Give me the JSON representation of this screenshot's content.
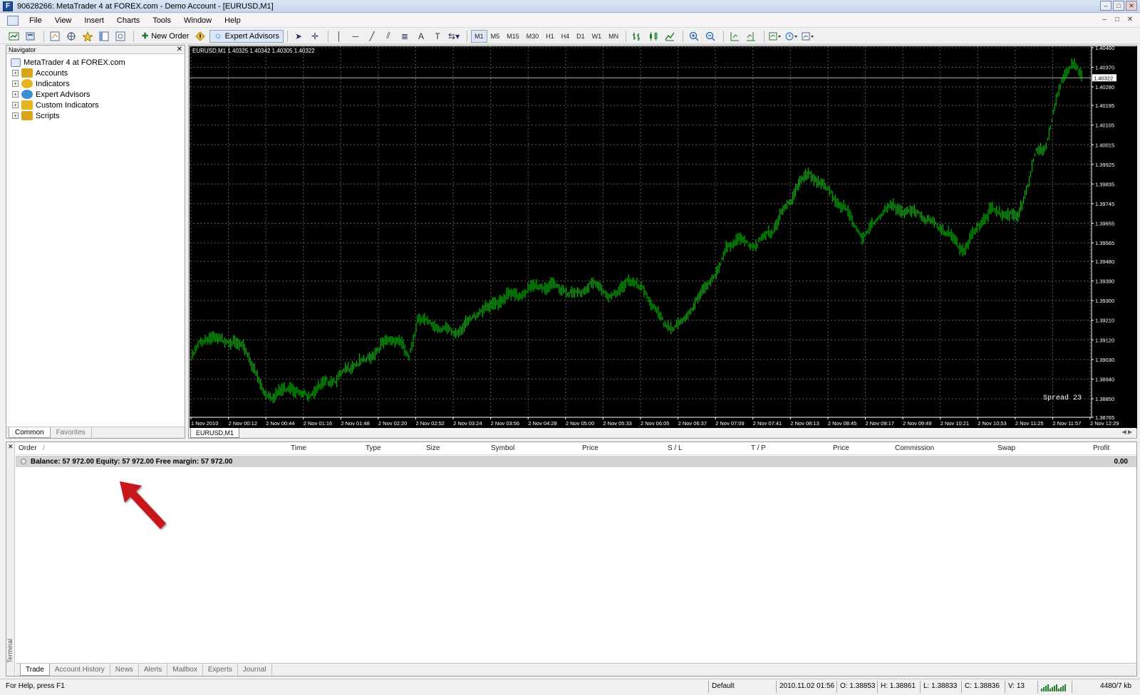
{
  "window": {
    "title": "90628266: MetaTrader 4 at FOREX.com - Demo Account - [EURUSD,M1]",
    "app_icon_letter": "F",
    "controls": [
      "–",
      "□",
      "✕"
    ]
  },
  "menu": {
    "items": [
      "File",
      "View",
      "Insert",
      "Charts",
      "Tools",
      "Window",
      "Help"
    ],
    "mdi_controls": [
      "–",
      "□",
      "✕"
    ]
  },
  "toolbar": {
    "new_order_label": "New Order",
    "expert_advisors_label": "Expert Advisors",
    "timeframes": [
      "M1",
      "M5",
      "M15",
      "M30",
      "H1",
      "H4",
      "D1",
      "W1",
      "MN"
    ]
  },
  "navigator": {
    "title": "Navigator",
    "root": "MetaTrader 4 at FOREX.com",
    "items": [
      {
        "label": "Accounts",
        "icon": "accounts-icon",
        "color": "#d8a51c"
      },
      {
        "label": "Indicators",
        "icon": "indicators-icon",
        "color": "#e6b41e"
      },
      {
        "label": "Expert Advisors",
        "icon": "expert-advisors-icon",
        "color": "#3a8fd0"
      },
      {
        "label": "Custom Indicators",
        "icon": "custom-indicators-icon",
        "color": "#e6b41e"
      },
      {
        "label": "Scripts",
        "icon": "scripts-icon",
        "color": "#d8a51c"
      }
    ],
    "tabs": [
      "Common",
      "Favorites"
    ]
  },
  "chart": {
    "info_line": "EURUSD,M1  1.40325 1.40342 1.40305 1.40322",
    "spread_label": "Spread 23",
    "current_price": "1.40322",
    "tab_label": "EURUSD,M1",
    "colors": {
      "background": "#000000",
      "candles": "#00b400",
      "grid": "#5a5a5a",
      "axis_text": "#ffffff"
    }
  },
  "chart_data": {
    "type": "line",
    "symbol": "EURUSD",
    "timeframe": "M1",
    "ohlc_last": {
      "open": 1.40325,
      "high": 1.40342,
      "low": 1.40305,
      "close": 1.40322
    },
    "ylim": [
      1.38765,
      1.4046
    ],
    "y_ticks": [
      "1.40460",
      "1.40370",
      "1.40280",
      "1.40195",
      "1.40105",
      "1.40015",
      "1.39925",
      "1.39835",
      "1.39745",
      "1.39655",
      "1.39565",
      "1.39480",
      "1.39390",
      "1.39300",
      "1.39210",
      "1.39120",
      "1.39030",
      "1.38940",
      "1.38850",
      "1.38765"
    ],
    "x_ticks": [
      "1 Nov 2010",
      "2 Nov 00:12",
      "2 Nov 00:44",
      "2 Nov 01:16",
      "2 Nov 01:48",
      "2 Nov 02:20",
      "2 Nov 02:52",
      "2 Nov 03:24",
      "2 Nov 03:56",
      "2 Nov 04:28",
      "2 Nov 05:00",
      "2 Nov 05:33",
      "2 Nov 06:05",
      "2 Nov 06:37",
      "2 Nov 07:09",
      "2 Nov 07:41",
      "2 Nov 08:13",
      "2 Nov 08:45",
      "2 Nov 09:17",
      "2 Nov 09:49",
      "2 Nov 10:21",
      "2 Nov 10:53",
      "2 Nov 11:25",
      "2 Nov 11:57",
      "2 Nov 12:29"
    ],
    "series": [
      {
        "values": [
          1.3903,
          1.3911,
          1.3913,
          1.3912,
          1.3912,
          1.391,
          1.3908,
          1.3898,
          1.3888,
          1.3886,
          1.3889,
          1.3891,
          1.3887,
          1.3887,
          1.389,
          1.3893,
          1.3894,
          1.3898,
          1.3901,
          1.3902,
          1.3905,
          1.391,
          1.3912,
          1.3912,
          1.3903,
          1.3923,
          1.392,
          1.3918,
          1.3917,
          1.3915,
          1.3918,
          1.3922,
          1.3926,
          1.3927,
          1.393,
          1.3933,
          1.3932,
          1.3935,
          1.3937,
          1.3936,
          1.3937,
          1.3935,
          1.3933,
          1.3934,
          1.3938,
          1.3936,
          1.3932,
          1.3933,
          1.394,
          1.3937,
          1.3934,
          1.3926,
          1.392,
          1.3917,
          1.392,
          1.3926,
          1.3932,
          1.3939,
          1.3943,
          1.3955,
          1.3958,
          1.3957,
          1.3955,
          1.3959,
          1.3962,
          1.397,
          1.3976,
          1.3985,
          1.3988,
          1.3985,
          1.3981,
          1.3976,
          1.3972,
          1.3965,
          1.3958,
          1.3965,
          1.397,
          1.3973,
          1.3972,
          1.397,
          1.3971,
          1.3967,
          1.3965,
          1.3962,
          1.3958,
          1.3953,
          1.396,
          1.3966,
          1.3972,
          1.397,
          1.397,
          1.3968,
          1.3982,
          1.3998,
          1.4,
          1.4018,
          1.4033,
          1.404,
          1.4032
        ]
      }
    ],
    "grid": true,
    "current_price_line": 1.40322
  },
  "terminal": {
    "side_label": "Terminal",
    "columns": [
      "Order",
      "/",
      "Time",
      "Type",
      "Size",
      "Symbol",
      "Price",
      "S / L",
      "T / P",
      "Price",
      "Commission",
      "Swap",
      "Profit"
    ],
    "balance_text": "Balance: 57 972.00  Equity: 57 972.00  Free margin: 57 972.00",
    "total_profit": "0.00",
    "tabs": [
      "Trade",
      "Account History",
      "News",
      "Alerts",
      "Mailbox",
      "Experts",
      "Journal"
    ]
  },
  "annotation": {
    "arrow_color": "#c8171c"
  },
  "statusbar": {
    "help": "For Help, press F1",
    "profile": "Default",
    "datetime": "2010.11.02 01:56",
    "open": "O: 1.38853",
    "high": "H: 1.38861",
    "low": "L: 1.38833",
    "close": "C: 1.38836",
    "volume": "V: 13",
    "traffic": "4480/7 kb"
  }
}
